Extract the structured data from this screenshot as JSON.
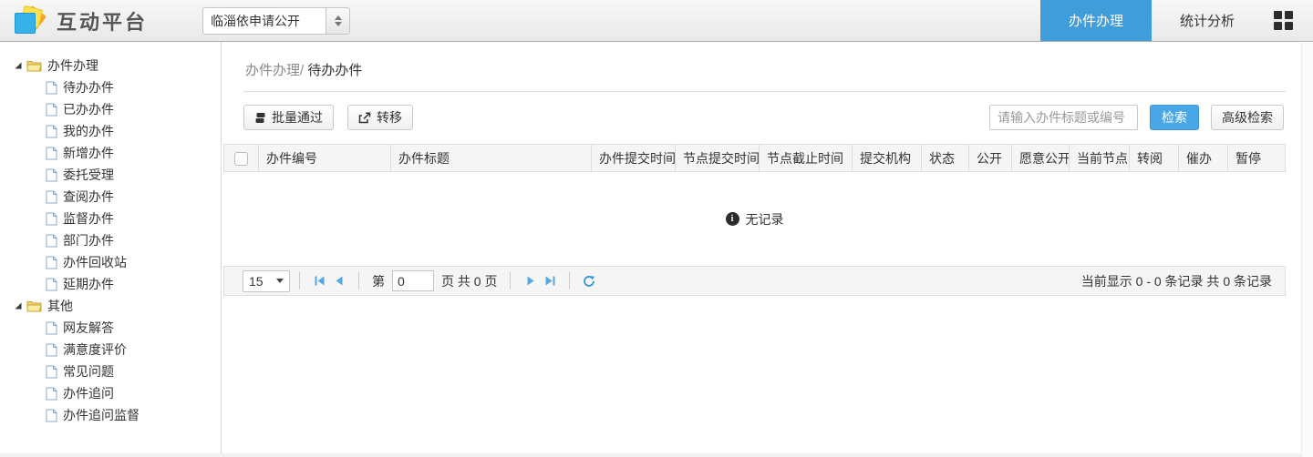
{
  "header": {
    "app_title": "互动平台",
    "site_select": {
      "value": "临淄依申请公开"
    },
    "tabs": [
      {
        "label": "办件办理",
        "active": true
      },
      {
        "label": "统计分析",
        "active": false
      }
    ]
  },
  "sidebar": {
    "groups": [
      {
        "label": "办件办理",
        "items": [
          "待办办件",
          "已办办件",
          "我的办件",
          "新增办件",
          "委托受理",
          "查阅办件",
          "监督办件",
          "部门办件",
          "办件回收站",
          "延期办件"
        ]
      },
      {
        "label": "其他",
        "items": [
          "网友解答",
          "满意度评价",
          "常见问题",
          "办件追问",
          "办件追问监督"
        ]
      }
    ]
  },
  "main": {
    "breadcrumb": {
      "parent": "办件办理/",
      "current": "待办办件"
    },
    "toolbar": {
      "batch_approve_label": "批量通过",
      "transfer_label": "转移"
    },
    "search": {
      "placeholder": "请输入办件标题或编号",
      "search_label": "检索",
      "advanced_label": "高级检索"
    },
    "table": {
      "columns": [
        "办件编号",
        "办件标题",
        "办件提交时间",
        "节点提交时间",
        "节点截止时间",
        "提交机构",
        "状态",
        "公开",
        "愿意公开",
        "当前节点",
        "转阅",
        "催办",
        "暂停"
      ],
      "empty_text": "无记录",
      "info_glyph": "i"
    },
    "pagination": {
      "page_size": "15",
      "page_label_prefix": "第",
      "page_value": "0",
      "page_label_suffix": "页 共 0 页",
      "records_info": "当前显示 0 - 0 条记录 共 0 条记录"
    }
  },
  "icons": {
    "app_logo": "layered-color-squares",
    "select_spinner": "up-down-triangles",
    "apps_grid": "2x2-squares",
    "tree_expanded": "corner-triangle",
    "folder": "open-yellow-folder",
    "file": "page-with-folded-corner",
    "batch_approve": "stacked-sheets",
    "transfer": "export-arrow",
    "pager": "first/prev/next/last triangles + refresh circular arrow",
    "empty_info": "dark-circle-i"
  },
  "colors": {
    "active_tab_blue": "#3f9dda",
    "search_button_blue": "#49a7e8",
    "pager_icon_blue": "#54a9e0",
    "refresh_icon_blue": "#2f96d8",
    "header_border": "#aeaeae",
    "grid_header_bg": "#f5f5f5",
    "border_gray": "#dddddd"
  }
}
